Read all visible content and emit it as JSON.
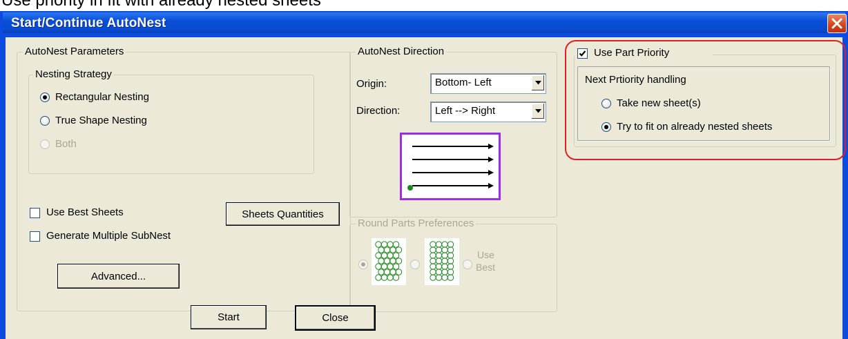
{
  "top_strip_text": "Use priority in fit with already nested sheets",
  "window": {
    "title": "Start/Continue AutoNest"
  },
  "parameters": {
    "group_title": "AutoNest Parameters",
    "strategy_title": "Nesting Strategy",
    "strategy_options": [
      {
        "label": "Rectangular Nesting",
        "checked": true,
        "disabled": false
      },
      {
        "label": "True Shape Nesting",
        "checked": false,
        "disabled": false
      },
      {
        "label": "Both",
        "checked": false,
        "disabled": true
      }
    ],
    "use_best_sheets": {
      "label": "Use Best Sheets",
      "checked": false
    },
    "sheets_quantities_label": "Sheets Quantities",
    "generate_multiple_subnest": {
      "label": "Generate Multiple SubNest",
      "checked": false
    },
    "advanced_label": "Advanced..."
  },
  "direction": {
    "group_title": "AutoNest Direction",
    "origin_label": "Origin:",
    "origin_value": "Bottom- Left",
    "direction_label": "Direction:",
    "direction_value": "Left --> Right",
    "preview_colors": {
      "border": "#9a2de8",
      "arrow": "#000000",
      "origin_dot": "#1a8a1a"
    }
  },
  "round_parts": {
    "group_title": "Round Parts Preferences",
    "options": [
      {
        "name": "pattern-a",
        "checked": true
      },
      {
        "name": "pattern-b",
        "checked": false
      },
      {
        "name": "use-best",
        "checked": false,
        "label_line1": "Use",
        "label_line2": "Best"
      }
    ],
    "circle_color": "#1a8a1a"
  },
  "priority": {
    "use_part_priority": {
      "label": "Use Part Priority",
      "checked": true
    },
    "handling_title": "Next Prtiority handling",
    "options": [
      {
        "label": "Take new sheet(s)",
        "checked": false
      },
      {
        "label": "Try to fit on already nested sheets",
        "checked": true
      }
    ],
    "highlight_color": "#e02020"
  },
  "footer": {
    "start_label": "Start",
    "close_label": "Close"
  }
}
